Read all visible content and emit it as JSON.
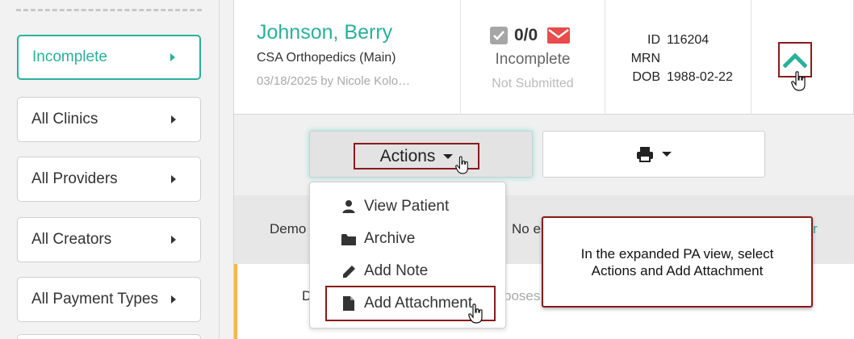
{
  "sidebar": {
    "filters": [
      {
        "label": "Incomplete",
        "active": true
      },
      {
        "label": "All Clinics",
        "active": false
      },
      {
        "label": "All Providers",
        "active": false
      },
      {
        "label": "All Creators",
        "active": false
      },
      {
        "label": "All Payment Types",
        "active": false
      }
    ]
  },
  "card": {
    "patient_name": "Johnson, Berry",
    "clinic": "CSA Orthopedics (Main)",
    "created": "03/18/2025 by Nicole Kolo…",
    "count": "0/0",
    "status": "Incomplete",
    "submission": "Not Submitted",
    "ids": [
      {
        "key": "ID",
        "value": "116204"
      },
      {
        "key": "MRN",
        "value": ""
      },
      {
        "key": "DOB",
        "value": "1988-02-22"
      }
    ]
  },
  "actions": {
    "label": "Actions"
  },
  "menu": {
    "items": [
      {
        "label": "View Patient",
        "icon": "user-icon"
      },
      {
        "label": "Archive",
        "icon": "folder-icon"
      },
      {
        "label": "Add Note",
        "icon": "pencil-icon"
      },
      {
        "label": "Add Attachment",
        "icon": "file-icon"
      }
    ]
  },
  "lower": {
    "demo_label": "Demo",
    "noe_text": "No e",
    "teal_r": "r",
    "d_label": "D",
    "poses_text": "poses c"
  },
  "callout": {
    "text": "In the expanded PA view, select Actions and Add Attachment"
  },
  "colors": {
    "accent": "#2ab09b",
    "highlight": "#8b1a1a",
    "alert": "#e84c4c"
  }
}
